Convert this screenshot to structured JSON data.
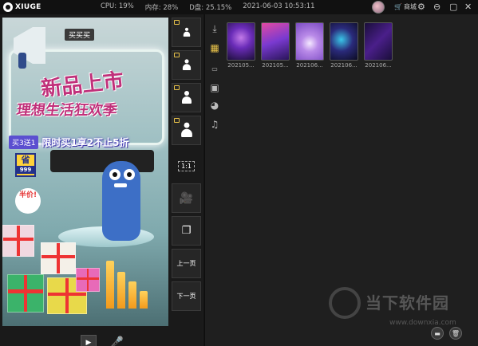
{
  "app": {
    "name": "XIUGE"
  },
  "stats": {
    "cpu": "CPU: 19%",
    "memory": "内存: 28%",
    "disk": "D盘: 25.15%",
    "datetime": "2021-06-03 10:53:11"
  },
  "header": {
    "store_label": "商城"
  },
  "phone_screen": {
    "top_banner": "买买买",
    "headline": "新品上市",
    "subheadline": "理想生活狂欢季",
    "promo_badge": "买3送1",
    "promo_text": "限时买1享2不止5折",
    "sheng_label": "省",
    "sheng_price": "999",
    "half_price": "半价!"
  },
  "tools": {
    "ratio_label": "1:1",
    "prev_page": "上一页",
    "next_page": "下一页"
  },
  "thumbnails": [
    {
      "caption": "202105..."
    },
    {
      "caption": "202105..."
    },
    {
      "caption": "202106..."
    },
    {
      "caption": "202106..."
    },
    {
      "caption": "202106..."
    }
  ],
  "watermark": {
    "brand": "当下软件园",
    "url": "www.downxia.com"
  },
  "colors": {
    "accent": "#e8c24a",
    "background": "#1f1f1f"
  }
}
